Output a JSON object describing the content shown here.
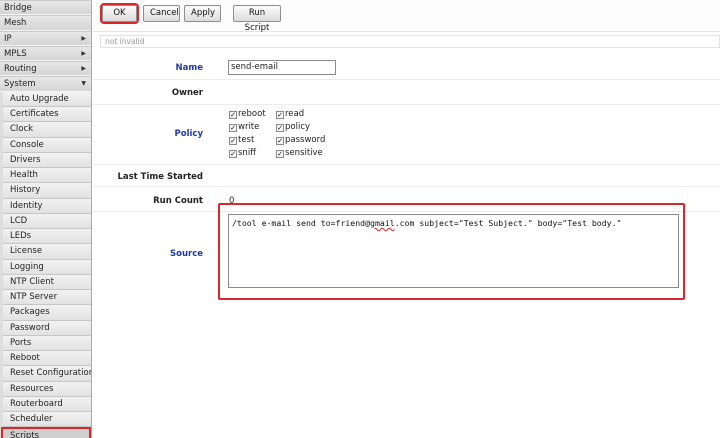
{
  "sidebar": {
    "menu": [
      {
        "label": "Bridge",
        "arrow": ""
      },
      {
        "label": "Mesh",
        "arrow": ""
      },
      {
        "label": "IP",
        "arrow": "▶"
      },
      {
        "label": "MPLS",
        "arrow": "▶"
      },
      {
        "label": "Routing",
        "arrow": "▶"
      },
      {
        "label": "System",
        "arrow": "▼"
      }
    ],
    "submenu": [
      "Auto Upgrade",
      "Certificates",
      "Clock",
      "Console",
      "Drivers",
      "Health",
      "History",
      "Identity",
      "LCD",
      "LEDs",
      "License",
      "Logging",
      "NTP Client",
      "NTP Server",
      "Packages",
      "Password",
      "Ports",
      "Reboot",
      "Reset Configuration",
      "Resources",
      "Routerboard",
      "Scheduler",
      "Scripts"
    ],
    "active": "Scripts"
  },
  "toolbar": {
    "ok": "OK",
    "cancel": "Cancel",
    "apply": "Apply",
    "run_script": "Run Script"
  },
  "status": "not invalid",
  "form": {
    "name_label": "Name",
    "name_value": "send-email",
    "owner_label": "Owner",
    "policy_label": "Policy",
    "policies": [
      {
        "label": "reboot",
        "checked": true
      },
      {
        "label": "read",
        "checked": true
      },
      {
        "label": "write",
        "checked": true
      },
      {
        "label": "policy",
        "checked": true
      },
      {
        "label": "test",
        "checked": true
      },
      {
        "label": "password",
        "checked": true
      },
      {
        "label": "sniff",
        "checked": true
      },
      {
        "label": "sensitive",
        "checked": true
      }
    ],
    "last_time_started_label": "Last Time Started",
    "run_count_label": "Run Count",
    "run_count_value": "0",
    "source_label": "Source",
    "source_pre": "/tool e-mail send to=friend@",
    "source_squig": "gmail",
    "source_post": ".com subject=\"Test Subject.\" body=\"Test body.\""
  },
  "colors": {
    "highlight": "#d9282c",
    "label_blue": "#1f3aa3"
  }
}
